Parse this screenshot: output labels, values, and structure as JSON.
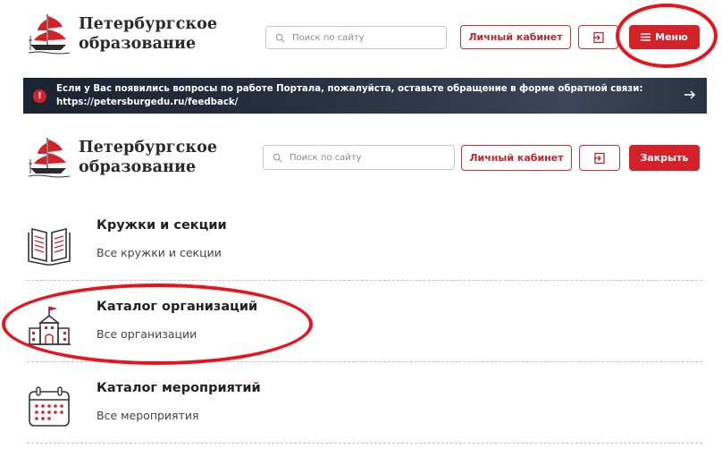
{
  "header_top": {
    "logo_line1": "Петербургское",
    "logo_line2": "образование",
    "search_placeholder": "Поиск по сайту",
    "cabinet_label": "Личный кабинет",
    "menu_label": "Меню"
  },
  "banner": {
    "line1": "Если у Вас появились вопросы по работе Портала, пожалуйста, оставьте обращение в форме обратной связи:",
    "line2": "https://petersburgedu.ru/feedback/"
  },
  "header_second": {
    "logo_line1": "Петербургское",
    "logo_line2": "образование",
    "search_placeholder": "Поиск по сайту",
    "cabinet_label": "Личный кабинет",
    "close_label": "Закрыть"
  },
  "menu_items": [
    {
      "title": "Кружки и секции",
      "subtitle": "Все кружки и секции",
      "icon": "book-icon"
    },
    {
      "title": "Каталог организаций",
      "subtitle": "Все организации",
      "icon": "school-building-icon"
    },
    {
      "title": "Каталог мероприятий",
      "subtitle": "Все мероприятия",
      "icon": "calendar-icon"
    }
  ],
  "colors": {
    "accent": "#d4222a",
    "annotation": "#e8141c",
    "banner_bg": "#1c2431"
  }
}
